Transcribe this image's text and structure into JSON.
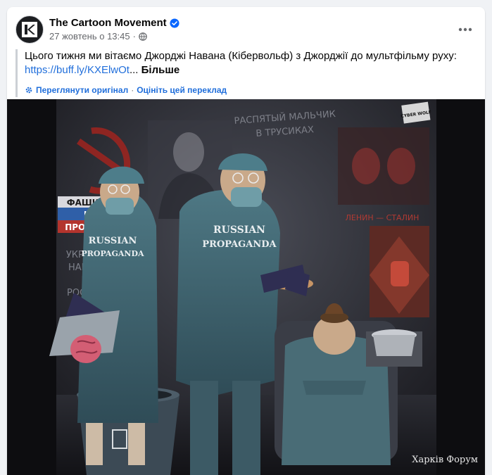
{
  "post": {
    "page_name": "The Cartoon Movement",
    "timestamp": "27 жовтень о 13:45",
    "separator": "·",
    "text": "Цього тижня ми вітаємо Джорджі Навана (Кібервольф) з Джорджії до мультфільму руху:",
    "link": "https://buff.ly/KXElwOt",
    "ellipsis": "...",
    "more_label": "Більше",
    "see_original": "Переглянути оригінал",
    "translate_sep": "·",
    "rate_translation": "Оцініть цей переклад"
  },
  "cartoon": {
    "wall_text_top_line1": "РАСПЯТЫЙ МАЛЬЧИК",
    "wall_text_top_line2": "В ТРУСИКАХ",
    "sign_line1": "ФАШИЗМ",
    "sign_line2": "НЕ",
    "sign_line3": "ПРОЙДЕТ!",
    "wall_text_left_line1": "УКРАИНА",
    "wall_text_left_line2": "НАПАЛА",
    "wall_text_left_line3": "НА",
    "wall_text_left_line4": "РОССИЮ",
    "wall_text_right": "ЛЕНИН — СТАЛИН",
    "gown_text_1_line1": "RUSSIAN",
    "gown_text_1_line2": "PROPAGANDA",
    "gown_text_2_line1": "RUSSIAN",
    "gown_text_2_line2": "PROPAGANDA",
    "signature": "CYBER WOLF",
    "watermark": "Харків Форум"
  },
  "colors": {
    "link": "#216fdb",
    "verified": "#0866ff"
  },
  "icons": {
    "avatar": "cartoon-movement-logo-icon",
    "verified": "verified-badge-icon",
    "audience": "globe-icon",
    "more": "more-horizontal-icon",
    "translate": "gear-icon"
  }
}
